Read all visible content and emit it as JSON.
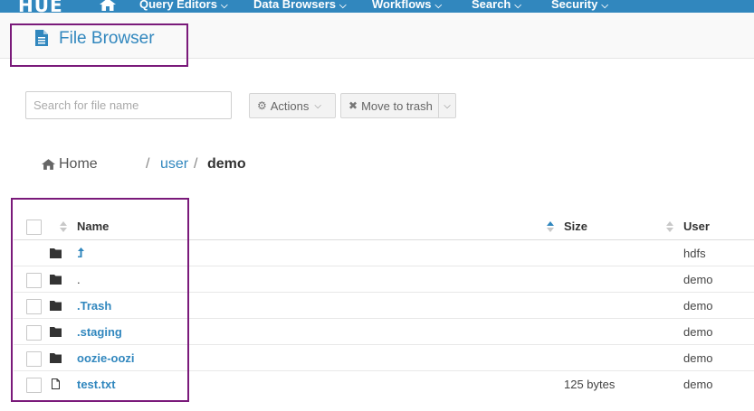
{
  "navbar": {
    "logo": "HUE",
    "items": [
      {
        "label": "Query Editors"
      },
      {
        "label": "Data Browsers"
      },
      {
        "label": "Workflows"
      },
      {
        "label": "Search"
      },
      {
        "label": "Security"
      }
    ],
    "color": "#3187be"
  },
  "page": {
    "title": "File Browser",
    "highlight_color": "#7a1a7a"
  },
  "toolbar": {
    "search_placeholder": "Search for file name",
    "actions_label": "Actions",
    "trash_label": "Move to trash"
  },
  "breadcrumb": {
    "home": "Home",
    "separator": "/",
    "segments": [
      "user",
      "demo"
    ]
  },
  "table": {
    "columns": {
      "name": "Name",
      "size": "Size",
      "user": "User"
    },
    "rows": [
      {
        "type": "folder",
        "name": "",
        "size": "",
        "user": "hdfs",
        "checkbox": false
      },
      {
        "type": "folder",
        "name": ".",
        "size": "",
        "user": "demo",
        "checkbox": true
      },
      {
        "type": "folder",
        "name": ".Trash",
        "size": "",
        "user": "demo",
        "checkbox": true
      },
      {
        "type": "folder",
        "name": ".staging",
        "size": "",
        "user": "demo",
        "checkbox": true
      },
      {
        "type": "folder",
        "name": "oozie-oozi",
        "size": "",
        "user": "demo",
        "checkbox": true
      },
      {
        "type": "file",
        "name": "test.txt",
        "size": "125 bytes",
        "user": "demo",
        "checkbox": true
      }
    ]
  }
}
